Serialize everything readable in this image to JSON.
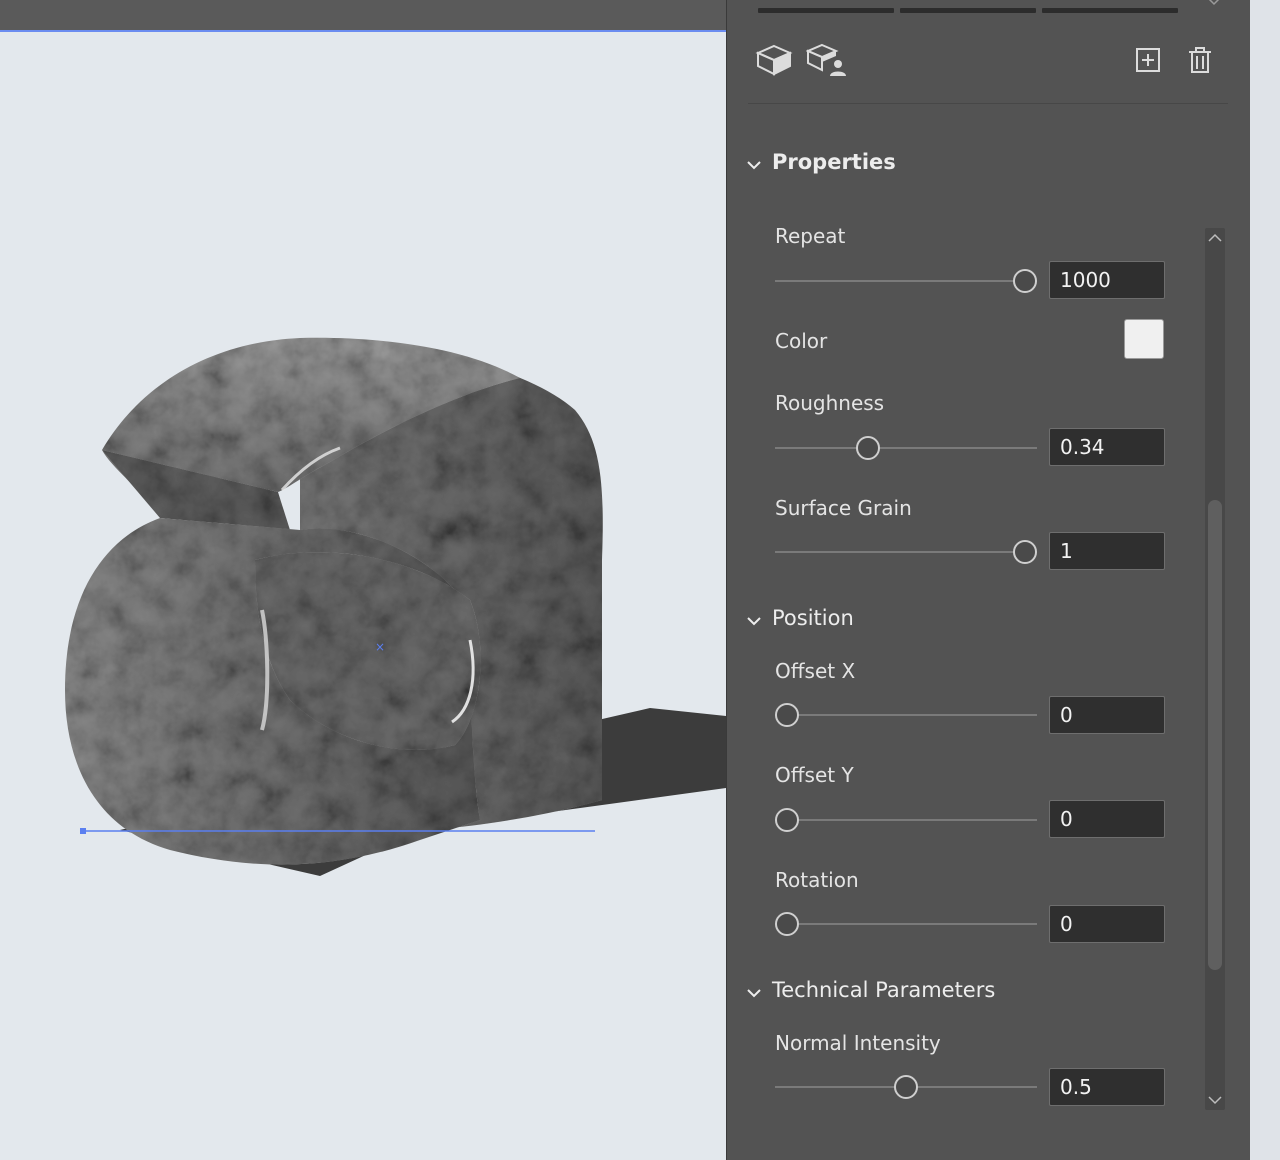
{
  "toolbar": {
    "icons": [
      "cube-icon",
      "cube-person-icon",
      "add-icon",
      "trash-icon"
    ]
  },
  "sections": {
    "properties": "Properties",
    "position": "Position",
    "technical": "Technical Parameters"
  },
  "properties": {
    "repeat": {
      "label": "Repeat",
      "value": "1000",
      "level": 1.0
    },
    "color": {
      "label": "Color",
      "swatch": "#f0f0f0"
    },
    "roughness": {
      "label": "Roughness",
      "value": "0.34",
      "level": 0.34
    },
    "surface_grain": {
      "label": "Surface Grain",
      "value": "1",
      "level": 1.0
    }
  },
  "position": {
    "offset_x": {
      "label": "Offset X",
      "value": "0",
      "level": 0
    },
    "offset_y": {
      "label": "Offset Y",
      "value": "0",
      "level": 0
    },
    "rotation": {
      "label": "Rotation",
      "value": "0",
      "level": 0
    }
  },
  "technical": {
    "normal_intensity": {
      "label": "Normal Intensity",
      "value": "0.5",
      "level": 0.5
    }
  },
  "colors": {
    "panel_bg": "#535353",
    "canvas_bg": "#e3e8ed",
    "selection_accent": "#5b7ff0"
  }
}
